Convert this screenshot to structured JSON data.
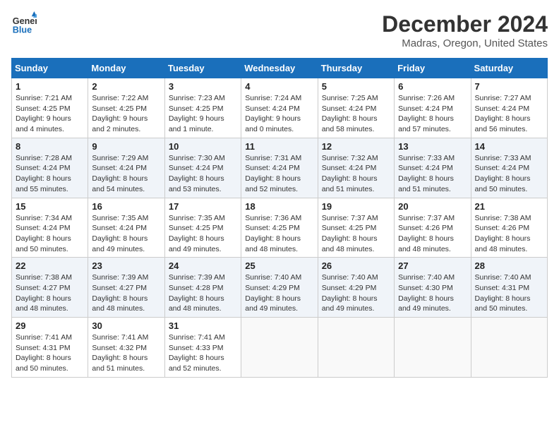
{
  "header": {
    "logo_line1": "General",
    "logo_line2": "Blue",
    "title": "December 2024",
    "subtitle": "Madras, Oregon, United States"
  },
  "weekdays": [
    "Sunday",
    "Monday",
    "Tuesday",
    "Wednesday",
    "Thursday",
    "Friday",
    "Saturday"
  ],
  "weeks": [
    [
      {
        "day": "1",
        "sunrise": "Sunrise: 7:21 AM",
        "sunset": "Sunset: 4:25 PM",
        "daylight": "Daylight: 9 hours and 4 minutes."
      },
      {
        "day": "2",
        "sunrise": "Sunrise: 7:22 AM",
        "sunset": "Sunset: 4:25 PM",
        "daylight": "Daylight: 9 hours and 2 minutes."
      },
      {
        "day": "3",
        "sunrise": "Sunrise: 7:23 AM",
        "sunset": "Sunset: 4:25 PM",
        "daylight": "Daylight: 9 hours and 1 minute."
      },
      {
        "day": "4",
        "sunrise": "Sunrise: 7:24 AM",
        "sunset": "Sunset: 4:24 PM",
        "daylight": "Daylight: 9 hours and 0 minutes."
      },
      {
        "day": "5",
        "sunrise": "Sunrise: 7:25 AM",
        "sunset": "Sunset: 4:24 PM",
        "daylight": "Daylight: 8 hours and 58 minutes."
      },
      {
        "day": "6",
        "sunrise": "Sunrise: 7:26 AM",
        "sunset": "Sunset: 4:24 PM",
        "daylight": "Daylight: 8 hours and 57 minutes."
      },
      {
        "day": "7",
        "sunrise": "Sunrise: 7:27 AM",
        "sunset": "Sunset: 4:24 PM",
        "daylight": "Daylight: 8 hours and 56 minutes."
      }
    ],
    [
      {
        "day": "8",
        "sunrise": "Sunrise: 7:28 AM",
        "sunset": "Sunset: 4:24 PM",
        "daylight": "Daylight: 8 hours and 55 minutes."
      },
      {
        "day": "9",
        "sunrise": "Sunrise: 7:29 AM",
        "sunset": "Sunset: 4:24 PM",
        "daylight": "Daylight: 8 hours and 54 minutes."
      },
      {
        "day": "10",
        "sunrise": "Sunrise: 7:30 AM",
        "sunset": "Sunset: 4:24 PM",
        "daylight": "Daylight: 8 hours and 53 minutes."
      },
      {
        "day": "11",
        "sunrise": "Sunrise: 7:31 AM",
        "sunset": "Sunset: 4:24 PM",
        "daylight": "Daylight: 8 hours and 52 minutes."
      },
      {
        "day": "12",
        "sunrise": "Sunrise: 7:32 AM",
        "sunset": "Sunset: 4:24 PM",
        "daylight": "Daylight: 8 hours and 51 minutes."
      },
      {
        "day": "13",
        "sunrise": "Sunrise: 7:33 AM",
        "sunset": "Sunset: 4:24 PM",
        "daylight": "Daylight: 8 hours and 51 minutes."
      },
      {
        "day": "14",
        "sunrise": "Sunrise: 7:33 AM",
        "sunset": "Sunset: 4:24 PM",
        "daylight": "Daylight: 8 hours and 50 minutes."
      }
    ],
    [
      {
        "day": "15",
        "sunrise": "Sunrise: 7:34 AM",
        "sunset": "Sunset: 4:24 PM",
        "daylight": "Daylight: 8 hours and 50 minutes."
      },
      {
        "day": "16",
        "sunrise": "Sunrise: 7:35 AM",
        "sunset": "Sunset: 4:24 PM",
        "daylight": "Daylight: 8 hours and 49 minutes."
      },
      {
        "day": "17",
        "sunrise": "Sunrise: 7:35 AM",
        "sunset": "Sunset: 4:25 PM",
        "daylight": "Daylight: 8 hours and 49 minutes."
      },
      {
        "day": "18",
        "sunrise": "Sunrise: 7:36 AM",
        "sunset": "Sunset: 4:25 PM",
        "daylight": "Daylight: 8 hours and 48 minutes."
      },
      {
        "day": "19",
        "sunrise": "Sunrise: 7:37 AM",
        "sunset": "Sunset: 4:25 PM",
        "daylight": "Daylight: 8 hours and 48 minutes."
      },
      {
        "day": "20",
        "sunrise": "Sunrise: 7:37 AM",
        "sunset": "Sunset: 4:26 PM",
        "daylight": "Daylight: 8 hours and 48 minutes."
      },
      {
        "day": "21",
        "sunrise": "Sunrise: 7:38 AM",
        "sunset": "Sunset: 4:26 PM",
        "daylight": "Daylight: 8 hours and 48 minutes."
      }
    ],
    [
      {
        "day": "22",
        "sunrise": "Sunrise: 7:38 AM",
        "sunset": "Sunset: 4:27 PM",
        "daylight": "Daylight: 8 hours and 48 minutes."
      },
      {
        "day": "23",
        "sunrise": "Sunrise: 7:39 AM",
        "sunset": "Sunset: 4:27 PM",
        "daylight": "Daylight: 8 hours and 48 minutes."
      },
      {
        "day": "24",
        "sunrise": "Sunrise: 7:39 AM",
        "sunset": "Sunset: 4:28 PM",
        "daylight": "Daylight: 8 hours and 48 minutes."
      },
      {
        "day": "25",
        "sunrise": "Sunrise: 7:40 AM",
        "sunset": "Sunset: 4:29 PM",
        "daylight": "Daylight: 8 hours and 49 minutes."
      },
      {
        "day": "26",
        "sunrise": "Sunrise: 7:40 AM",
        "sunset": "Sunset: 4:29 PM",
        "daylight": "Daylight: 8 hours and 49 minutes."
      },
      {
        "day": "27",
        "sunrise": "Sunrise: 7:40 AM",
        "sunset": "Sunset: 4:30 PM",
        "daylight": "Daylight: 8 hours and 49 minutes."
      },
      {
        "day": "28",
        "sunrise": "Sunrise: 7:40 AM",
        "sunset": "Sunset: 4:31 PM",
        "daylight": "Daylight: 8 hours and 50 minutes."
      }
    ],
    [
      {
        "day": "29",
        "sunrise": "Sunrise: 7:41 AM",
        "sunset": "Sunset: 4:31 PM",
        "daylight": "Daylight: 8 hours and 50 minutes."
      },
      {
        "day": "30",
        "sunrise": "Sunrise: 7:41 AM",
        "sunset": "Sunset: 4:32 PM",
        "daylight": "Daylight: 8 hours and 51 minutes."
      },
      {
        "day": "31",
        "sunrise": "Sunrise: 7:41 AM",
        "sunset": "Sunset: 4:33 PM",
        "daylight": "Daylight: 8 hours and 52 minutes."
      },
      null,
      null,
      null,
      null
    ]
  ]
}
